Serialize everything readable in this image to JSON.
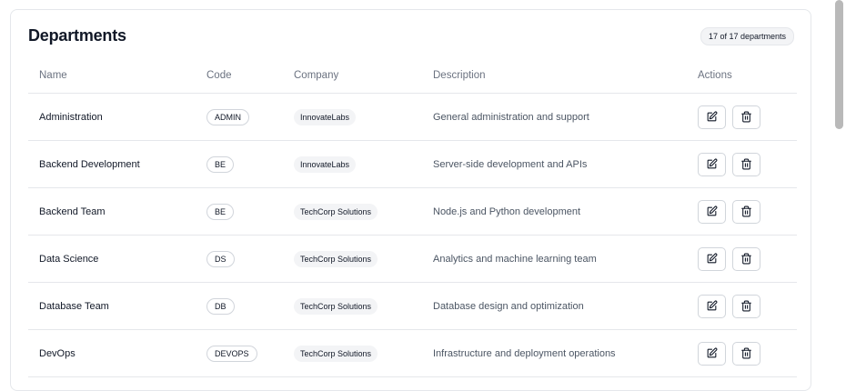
{
  "header": {
    "title": "Departments",
    "count_label": "17 of 17 departments"
  },
  "table": {
    "columns": {
      "name": "Name",
      "code": "Code",
      "company": "Company",
      "description": "Description",
      "actions": "Actions"
    },
    "rows": [
      {
        "name": "Administration",
        "code": "ADMIN",
        "company": "InnovateLabs",
        "description": "General administration and support"
      },
      {
        "name": "Backend Development",
        "code": "BE",
        "company": "InnovateLabs",
        "description": "Server-side development and APIs"
      },
      {
        "name": "Backend Team",
        "code": "BE",
        "company": "TechCorp Solutions",
        "description": "Node.js and Python development"
      },
      {
        "name": "Data Science",
        "code": "DS",
        "company": "TechCorp Solutions",
        "description": "Analytics and machine learning team"
      },
      {
        "name": "Database Team",
        "code": "DB",
        "company": "TechCorp Solutions",
        "description": "Database design and optimization"
      },
      {
        "name": "DevOps",
        "code": "DEVOPS",
        "company": "TechCorp Solutions",
        "description": "Infrastructure and deployment operations"
      }
    ]
  },
  "icons": {
    "edit": "edit-icon",
    "delete": "trash-icon"
  }
}
